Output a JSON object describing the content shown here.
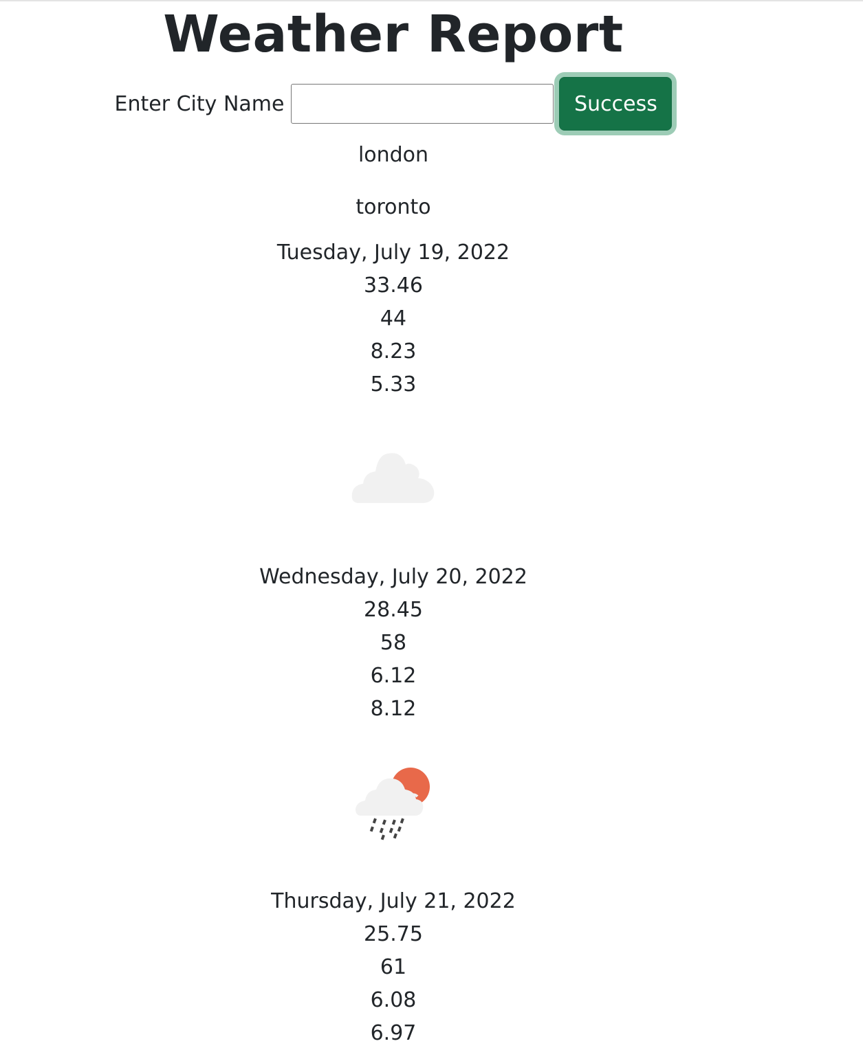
{
  "header": {
    "title": "Weather Report"
  },
  "search": {
    "label": "Enter City Name",
    "value": "",
    "placeholder": "",
    "button_label": "Success",
    "button_color": "#157347"
  },
  "cities": [
    "london",
    "toronto"
  ],
  "forecast": [
    {
      "date": "Tuesday, July 19, 2022",
      "values": [
        "33.46",
        "44",
        "8.23",
        "5.33"
      ],
      "icon": "cloud-icon"
    },
    {
      "date": "Wednesday, July 20, 2022",
      "values": [
        "28.45",
        "58",
        "6.12",
        "8.12"
      ],
      "icon": "rain-sun-cloud-icon"
    },
    {
      "date": "Thursday, July 21, 2022",
      "values": [
        "25.75",
        "61",
        "6.08",
        "6.97"
      ],
      "icon": ""
    }
  ]
}
